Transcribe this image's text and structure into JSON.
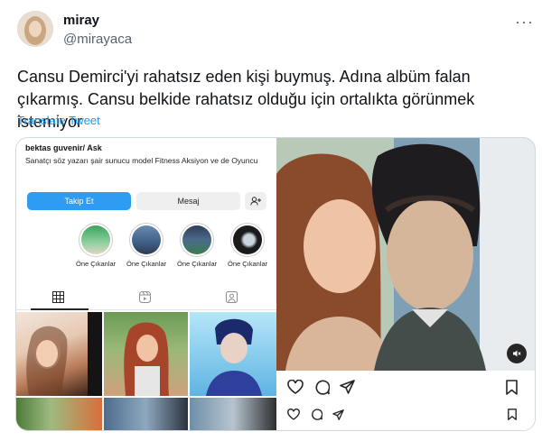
{
  "author": {
    "name": "miray",
    "handle": "@mirayaca"
  },
  "tweet": {
    "text": "Cansu Demirci'yi rahatsız eden kişi buymuş. Adına albüm falan çıkarmış. Cansu belkide rahatsız olduğu için ortalıkta görünmek istemiyor",
    "translate_label": "Translate Tweet",
    "more_icon": "more-icon"
  },
  "instagram_profile": {
    "username": "bektas guvenir/ Ask",
    "bio": "Sanatçı söz yazarı şair sunucu model Fitness Aksiyon ve de Oyuncu",
    "follow_label": "Takip Et",
    "message_label": "Mesaj",
    "add_user_icon": "add-user-icon",
    "highlights": [
      {
        "label": "Öne Çıkanlar"
      },
      {
        "label": "Öne Çıkanlar"
      },
      {
        "label": "Öne Çıkanlar"
      },
      {
        "label": "Öne Çıkanlar"
      }
    ],
    "tabs": [
      "grid-icon",
      "reels-icon",
      "tagged-icon"
    ]
  },
  "instagram_post": {
    "icons": [
      "heart-icon",
      "comment-icon",
      "share-icon",
      "bookmark-icon",
      "mute-icon"
    ]
  },
  "colors": {
    "accent": "#1d9bf0",
    "follow_button": "#2d9cf2",
    "muted_text": "#536471"
  }
}
